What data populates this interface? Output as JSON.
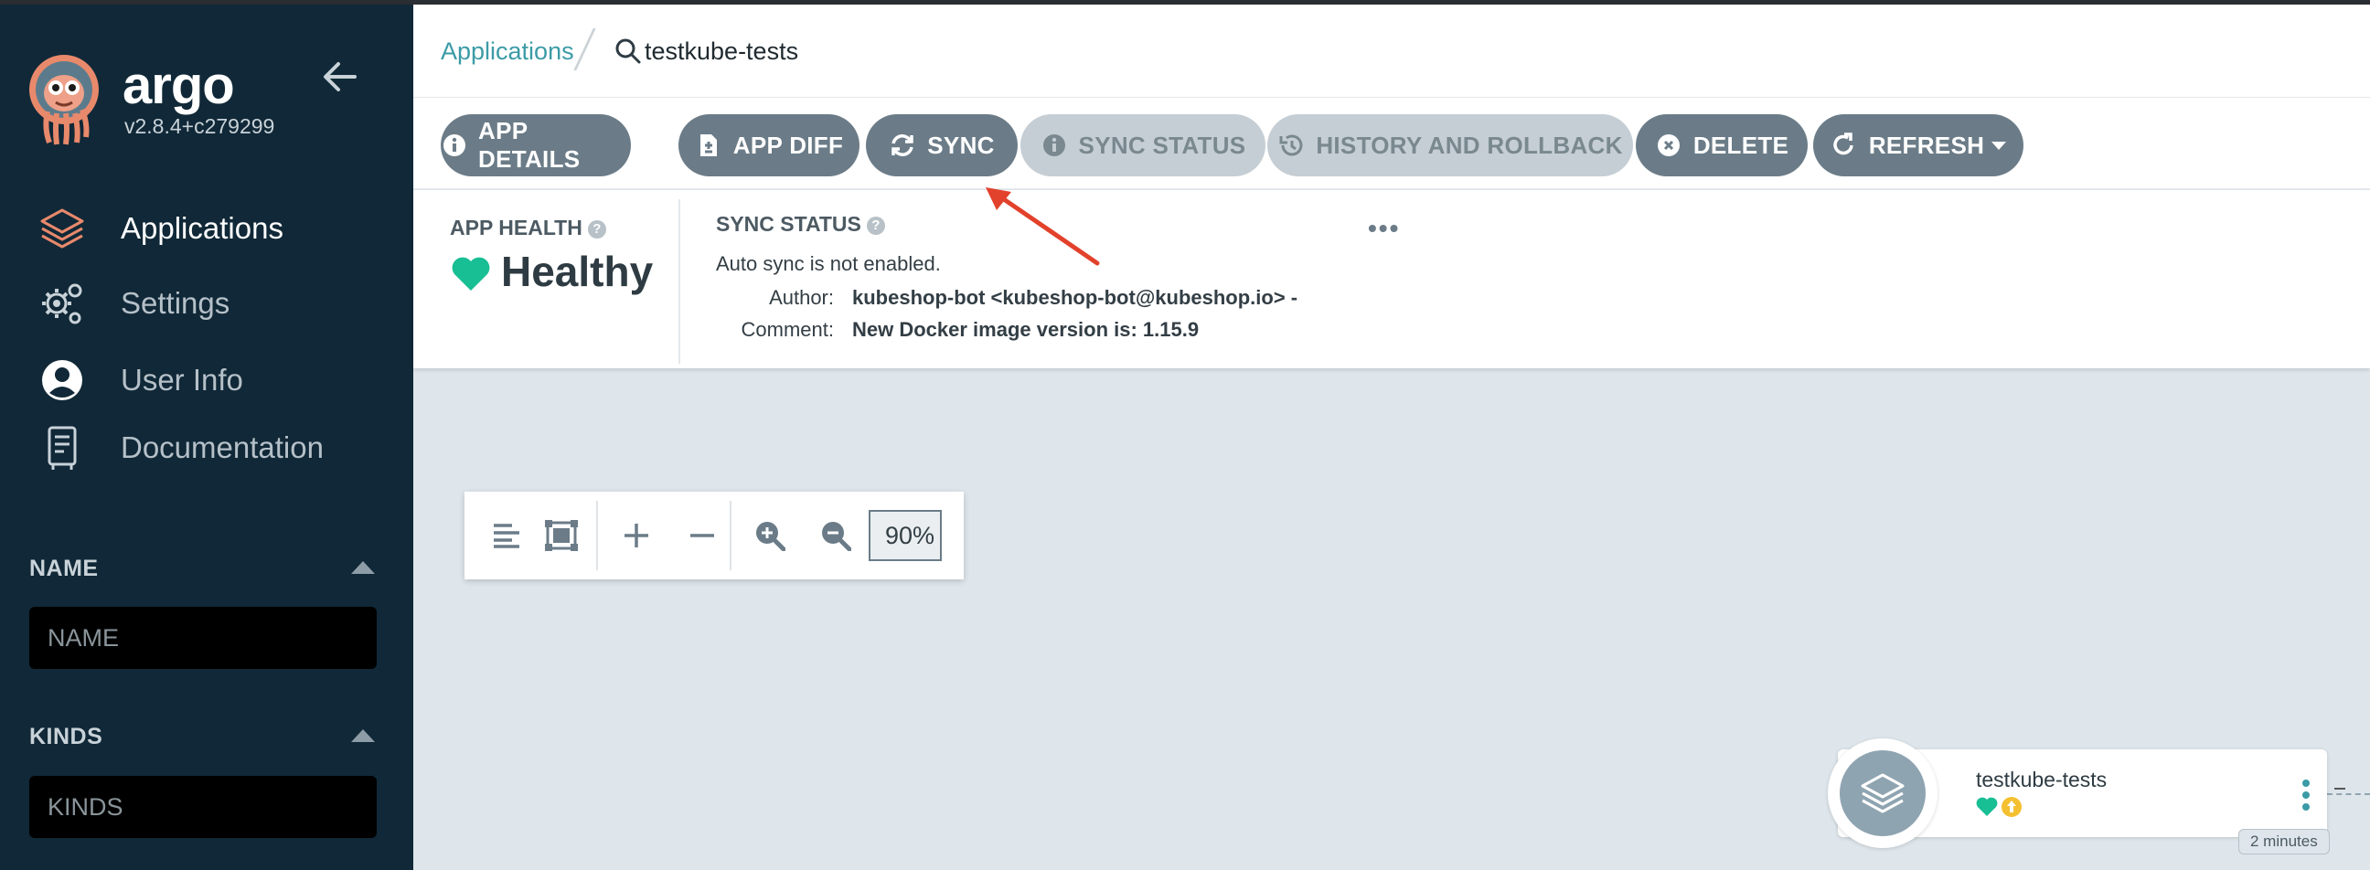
{
  "sidebar": {
    "brand": "argo",
    "version": "v2.8.4+c279299",
    "items": [
      {
        "label": "Applications",
        "icon": "layers-icon",
        "active": true
      },
      {
        "label": "Settings",
        "icon": "gears-icon"
      },
      {
        "label": "User Info",
        "icon": "user-circle-icon"
      },
      {
        "label": "Documentation",
        "icon": "book-icon"
      }
    ],
    "filters": [
      {
        "title": "NAME",
        "placeholder": "NAME"
      },
      {
        "title": "KINDS",
        "placeholder": "KINDS"
      }
    ]
  },
  "breadcrumb": {
    "root": "Applications",
    "current": "testkube-tests"
  },
  "toolbar": {
    "buttons": [
      {
        "label": "APP DETAILS",
        "icon": "info-icon"
      },
      {
        "label": "APP DIFF",
        "icon": "file-diff-icon"
      },
      {
        "label": "SYNC",
        "icon": "sync-icon"
      },
      {
        "label": "SYNC STATUS",
        "icon": "info-icon",
        "disabled": true
      },
      {
        "label": "HISTORY AND ROLLBACK",
        "icon": "history-icon",
        "disabled": true
      },
      {
        "label": "DELETE",
        "icon": "times-circle-icon"
      },
      {
        "label": "REFRESH",
        "icon": "refresh-icon"
      }
    ]
  },
  "status": {
    "health_title": "APP HEALTH",
    "health_value": "Healthy",
    "sync_title": "SYNC STATUS",
    "auto_sync": "Auto sync is not enabled.",
    "author_label": "Author:",
    "author_value": "kubeshop-bot <kubeshop-bot@kubeshop.io> -",
    "comment_label": "Comment:",
    "comment_value": "New Docker image version is: 1.15.9",
    "more": "•••"
  },
  "graph_toolbar": {
    "zoom": "90%"
  },
  "node": {
    "name": "testkube-tests",
    "age": "2 minutes"
  },
  "colors": {
    "sidebar_bg": "#102837",
    "accent_teal": "#3b9ba6",
    "button_bg": "#6b7c88",
    "healthy": "#18be94",
    "annotation_arrow": "#e2412b"
  }
}
